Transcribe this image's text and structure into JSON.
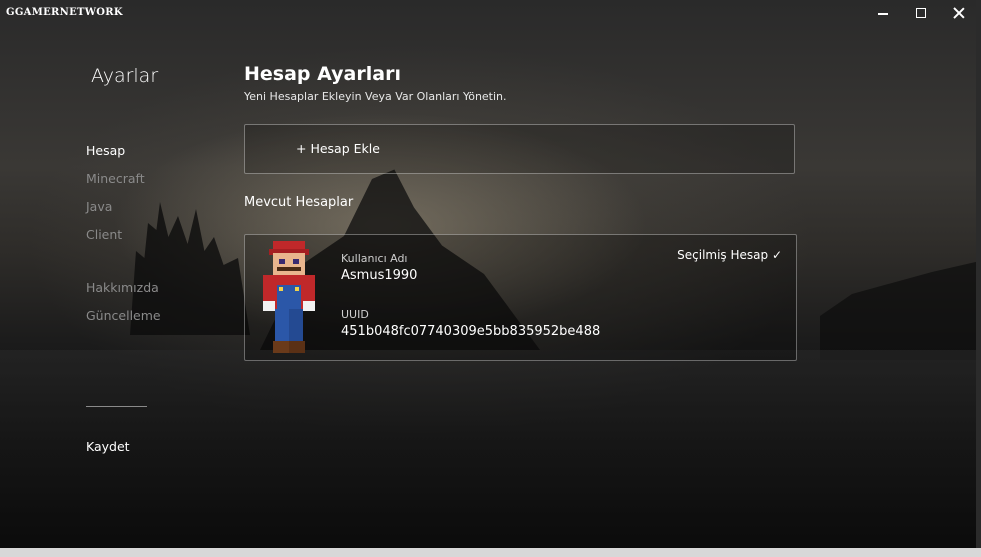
{
  "window": {
    "brand": "GGAMERNETWORK"
  },
  "sidebar": {
    "title": "Ayarlar",
    "items": [
      {
        "label": "Hesap",
        "active": true
      },
      {
        "label": "Minecraft",
        "active": false
      },
      {
        "label": "Java",
        "active": false
      },
      {
        "label": "Client",
        "active": false
      },
      {
        "label": "Hakkımızda",
        "active": false
      },
      {
        "label": "Güncelleme",
        "active": false
      }
    ],
    "save_label": "Kaydet"
  },
  "main": {
    "title": "Hesap Ayarları",
    "subtitle": "Yeni Hesaplar Ekleyin Veya Var Olanları Yönetin.",
    "add_account_label": "+ Hesap Ekle",
    "accounts_section_title": "Mevcut Hesaplar",
    "account": {
      "username_label": "Kullanıcı Adı",
      "username": "Asmus1990",
      "uuid_label": "UUID",
      "uuid": "451b048fc07740309e5bb835952be488",
      "selected_label": "Seçilmiş Hesap ✓"
    }
  },
  "colors": {
    "text": "#ffffff",
    "dim_text": "#8a8a8a",
    "border": "rgba(255,255,255,0.35)"
  }
}
